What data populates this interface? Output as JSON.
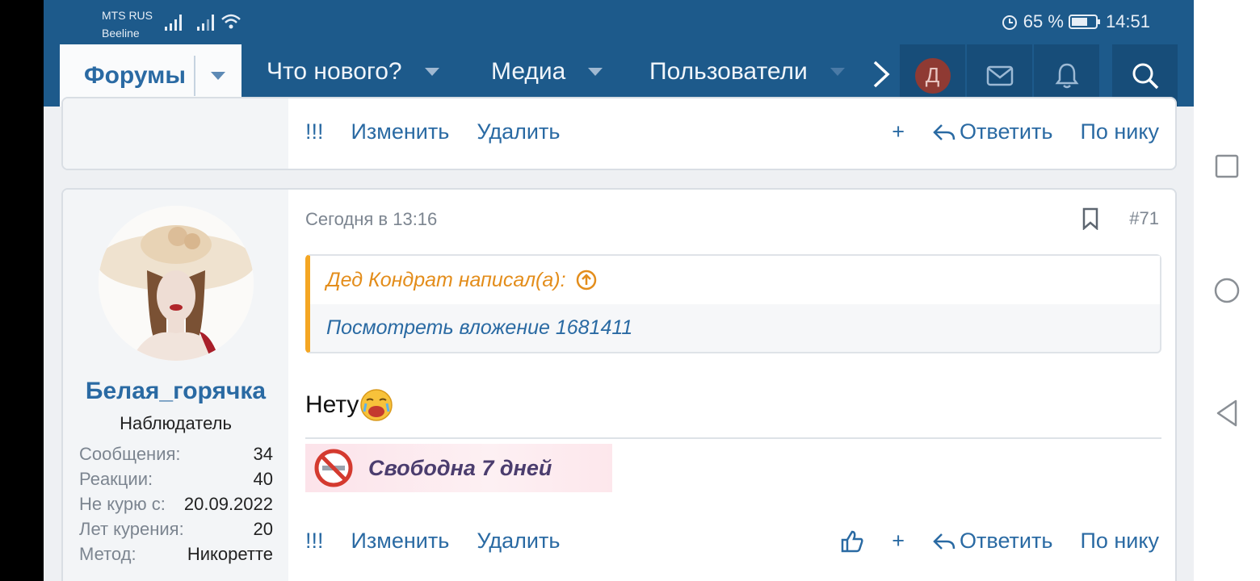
{
  "status": {
    "carrier1": "MTS RUS",
    "carrier2": "Beeline",
    "battery": "65 %",
    "time": "14:51"
  },
  "nav": {
    "forums": "Форумы",
    "whats_new": "Что нового?",
    "media": "Медиа",
    "users": "Пользователи",
    "avatar_letter": "Д"
  },
  "prev_post": {
    "actions": {
      "report": "!!!",
      "edit": "Изменить",
      "delete": "Удалить",
      "plus": "+",
      "reply": "Ответить",
      "by_nick": "По нику"
    }
  },
  "post": {
    "username": "Белая_горячка",
    "user_title": "Наблюдатель",
    "stats": [
      {
        "label": "Сообщения:",
        "value": "34"
      },
      {
        "label": "Реакции:",
        "value": "40"
      },
      {
        "label": "Не курю с:",
        "value": "20.09.2022"
      },
      {
        "label": "Лет курения:",
        "value": "20"
      },
      {
        "label": "Метод:",
        "value": "Никоретте"
      }
    ],
    "date": "Сегодня в 13:16",
    "number": "#71",
    "quote_author": "Дед Кондрат написал(а):",
    "quote_text": "Посмотреть вложение 1681411",
    "message": "Нету",
    "signature": "Свободна 7 дней",
    "actions": {
      "report": "!!!",
      "edit": "Изменить",
      "delete": "Удалить",
      "plus": "+",
      "reply": "Ответить",
      "by_nick": "По нику"
    }
  },
  "colors": {
    "header": "#1d5a8b",
    "link": "#2a6aa3",
    "quote_accent": "#f4a623"
  }
}
